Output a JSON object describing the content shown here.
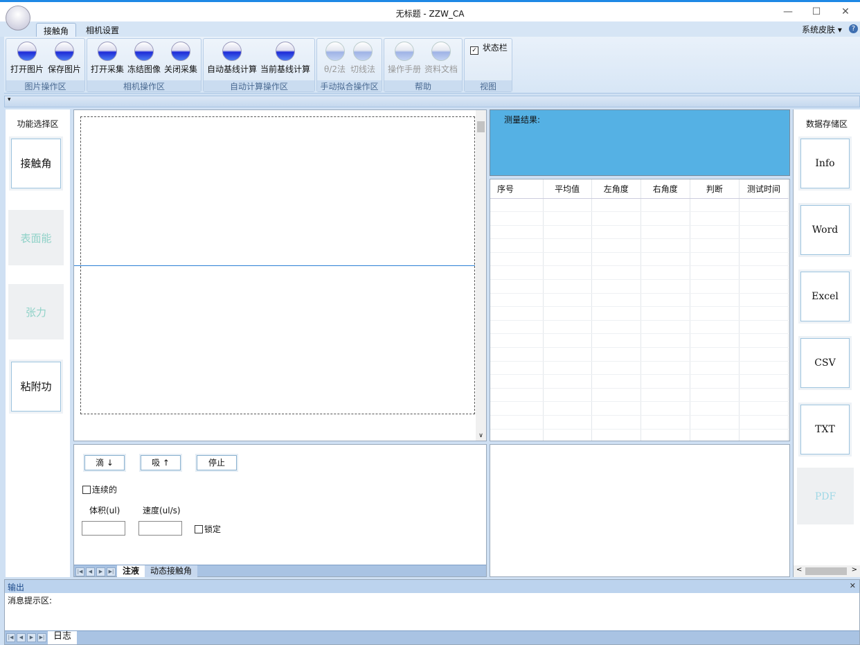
{
  "window": {
    "title": "无标题 - ZZW_CA",
    "minimize": "—",
    "maximize": "☐",
    "close": "✕"
  },
  "ribbon_tabs": [
    {
      "label": "接触角",
      "active": true
    },
    {
      "label": "相机设置",
      "active": false
    }
  ],
  "skin_menu": {
    "label": "系统皮肤",
    "arrow": "▾",
    "help": "?"
  },
  "groups": [
    {
      "label": "图片操作区",
      "buttons": [
        {
          "label": "打开图片",
          "icon": "folder-open-icon"
        },
        {
          "label": "保存图片",
          "icon": "folder-save-icon"
        }
      ]
    },
    {
      "label": "相机操作区",
      "buttons": [
        {
          "label": "打开采集",
          "icon": "video-camera-icon"
        },
        {
          "label": "冻结图像",
          "icon": "freeze-frame-icon"
        },
        {
          "label": "关闭采集",
          "icon": "camera-off-icon"
        }
      ]
    },
    {
      "label": "自动计算操作区",
      "buttons": [
        {
          "label": "自动基线计算",
          "icon": "droplet-baseline-icon"
        },
        {
          "label": "当前基线计算",
          "icon": "droplet-baseline-icon"
        }
      ]
    },
    {
      "label": "手动拟合操作区",
      "buttons": [
        {
          "label": "θ/2法",
          "icon": "droplet-icon",
          "disabled": true
        },
        {
          "label": "切线法",
          "icon": "droplet-icon",
          "disabled": true
        }
      ]
    },
    {
      "label": "帮助",
      "buttons": [
        {
          "label": "操作手册",
          "icon": "folder-icon",
          "disabled": true
        },
        {
          "label": "资料文档",
          "icon": "folder-icon",
          "disabled": true
        }
      ]
    },
    {
      "label": "视图",
      "checkbox": {
        "label": "状态栏",
        "checked": true
      }
    }
  ],
  "quick_access": "▾",
  "left_panel": {
    "title": "功能选择区",
    "buttons": [
      {
        "label": "接触角"
      },
      {
        "label": "表面能",
        "disabled": true
      },
      {
        "label": "张力",
        "disabled": true
      },
      {
        "label": "粘附功"
      }
    ]
  },
  "results": {
    "title": "测量结果:",
    "bg": "#55b1e4",
    "columns": [
      "序号",
      "平均值",
      "左角度",
      "右角度",
      "判断",
      "测试时间"
    ]
  },
  "injection": {
    "drip": "滴 ↓",
    "suck": "吸 ↑",
    "stop": "停止",
    "continuous": "连续的",
    "volume_label": "体积(ul)",
    "speed_label": "速度(ul/s)",
    "volume": "",
    "speed": "",
    "lock": "锁定",
    "tabs": [
      "注液",
      "动态接触角"
    ]
  },
  "right_panel": {
    "title": "数据存储区",
    "buttons": [
      {
        "label": "Info"
      },
      {
        "label": "Word"
      },
      {
        "label": "Excel"
      },
      {
        "label": "CSV"
      },
      {
        "label": "TXT"
      },
      {
        "label": "PDF",
        "disabled": true
      }
    ]
  },
  "output": {
    "title": "输出",
    "close": "✕",
    "message_label": "消息提示区:",
    "tab": "日志"
  },
  "nav_arrows": [
    "|◀",
    "◀",
    "▶",
    "▶|"
  ]
}
